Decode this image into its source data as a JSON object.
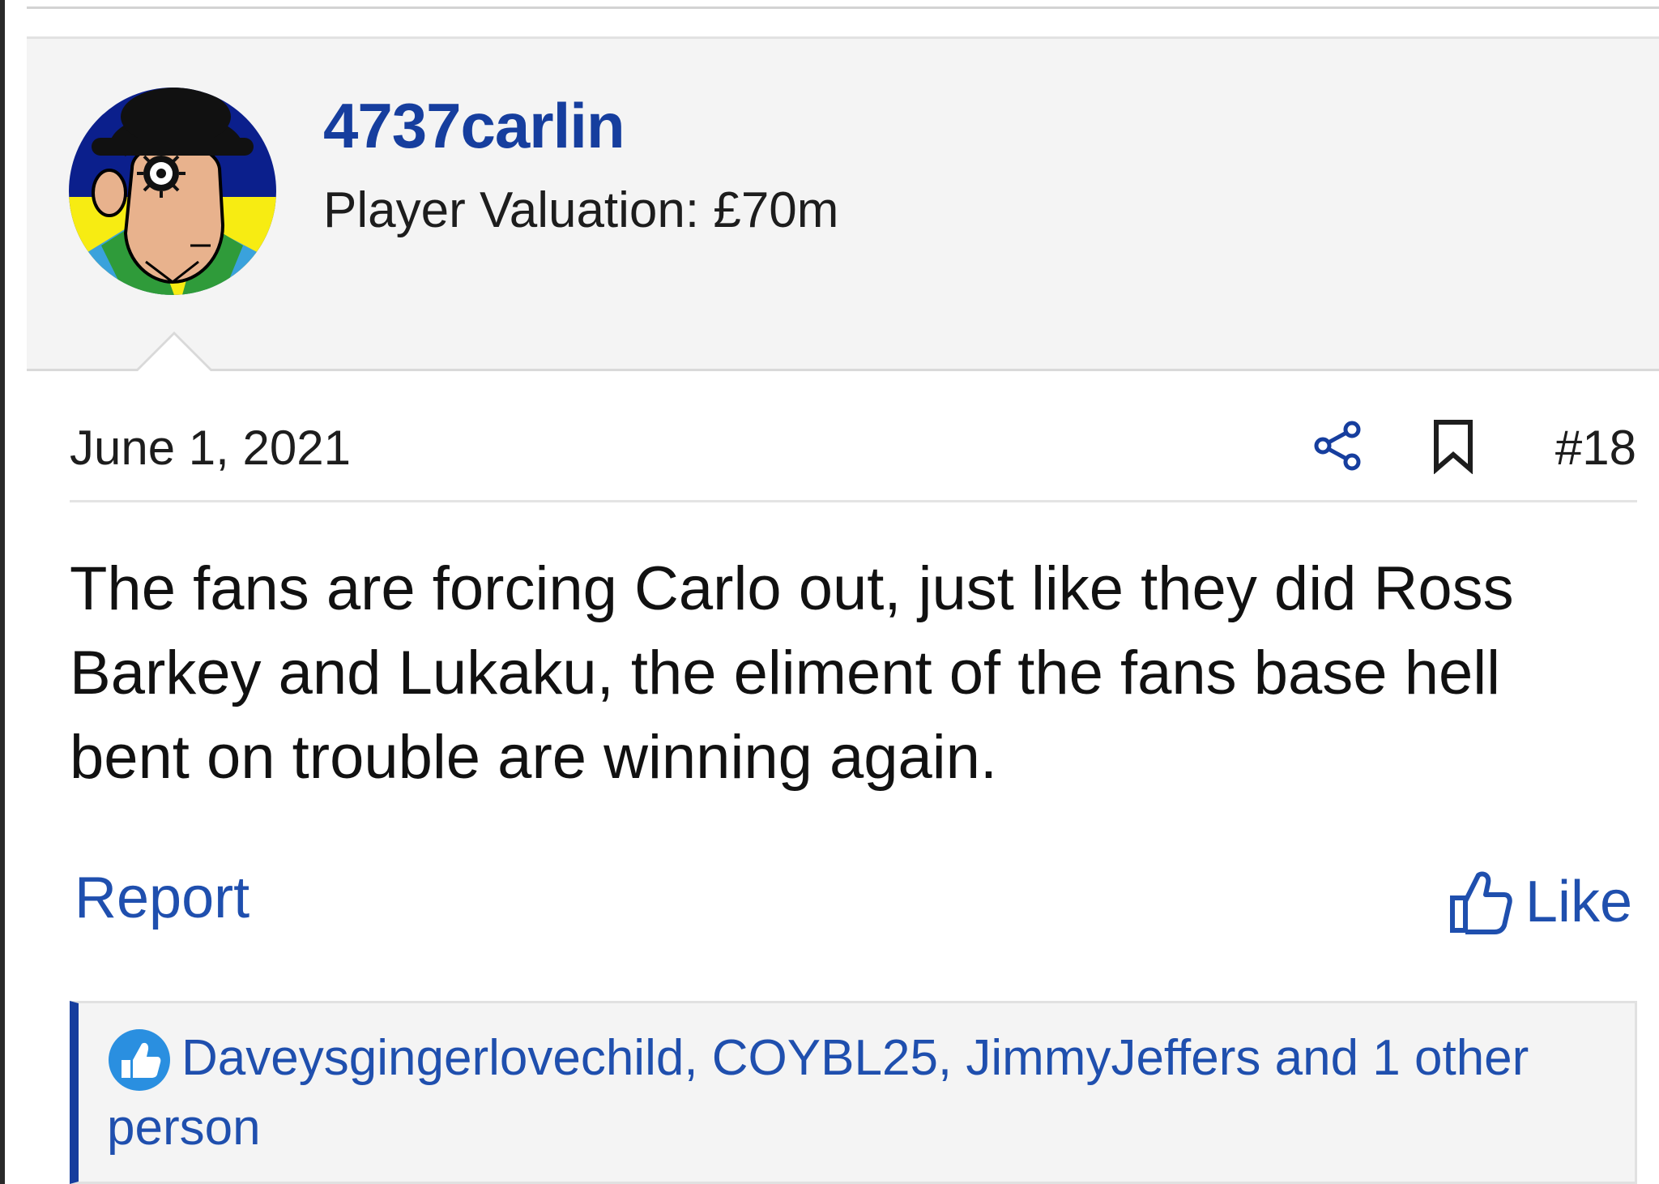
{
  "user": {
    "name": "4737carlin",
    "title": "Player Valuation: £70m",
    "avatar_icon": "avatar-image"
  },
  "post": {
    "date": "June 1, 2021",
    "number": "#18",
    "message": "The fans are forcing Carlo out, just like they did Ross Barkey and Lukaku, the eliment of the fans base hell bent on trouble are winning again.",
    "share_icon": "share-icon",
    "bookmark_icon": "bookmark-icon"
  },
  "actions": {
    "report_label": "Report",
    "like_label": "Like",
    "like_icon": "thumbs-up-icon"
  },
  "reactions": {
    "text": "Daveysgingerlovechild, COYBL25, JimmyJeffers and 1 other person",
    "icon": "like-reaction-icon"
  },
  "colors": {
    "accent": "#163e9e",
    "link": "#1f4fae",
    "header_bg": "#f4f4f4"
  }
}
